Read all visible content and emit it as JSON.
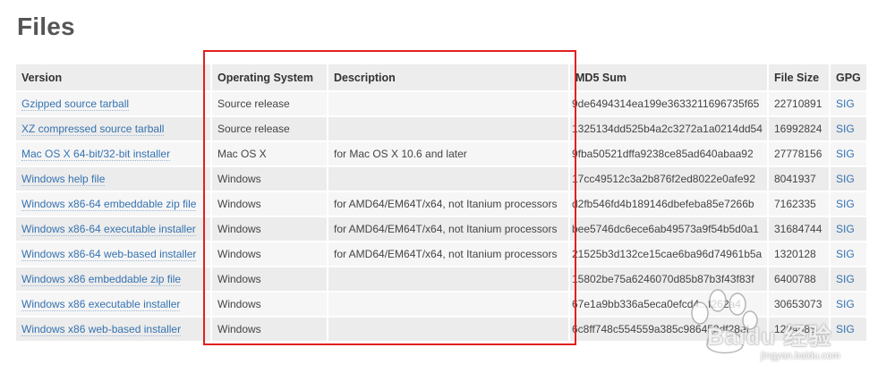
{
  "page": {
    "title": "Files"
  },
  "table": {
    "headers": {
      "version": "Version",
      "os": "Operating System",
      "description": "Description",
      "md5": "MD5 Sum",
      "size": "File Size",
      "gpg": "GPG"
    },
    "rows": [
      {
        "version": "Gzipped source tarball",
        "os": "Source release",
        "description": "",
        "md5": "9de6494314ea199e3633211696735f65",
        "size": "22710891",
        "gpg": "SIG"
      },
      {
        "version": "XZ compressed source tarball",
        "os": "Source release",
        "description": "",
        "md5": "1325134dd525b4a2c3272a1a0214dd54",
        "size": "16992824",
        "gpg": "SIG"
      },
      {
        "version": "Mac OS X 64-bit/32-bit installer",
        "os": "Mac OS X",
        "description": "for Mac OS X 10.6 and later",
        "md5": "9fba50521dffa9238ce85ad640abaa92",
        "size": "27778156",
        "gpg": "SIG"
      },
      {
        "version": "Windows help file",
        "os": "Windows",
        "description": "",
        "md5": "17cc49512c3a2b876f2ed8022e0afe92",
        "size": "8041937",
        "gpg": "SIG"
      },
      {
        "version": "Windows x86-64 embeddable zip file",
        "os": "Windows",
        "description": "for AMD64/EM64T/x64, not Itanium processors",
        "md5": "d2fb546fd4b189146dbefeba85e7266b",
        "size": "7162335",
        "gpg": "SIG"
      },
      {
        "version": "Windows x86-64 executable installer",
        "os": "Windows",
        "description": "for AMD64/EM64T/x64, not Itanium processors",
        "md5": "bee5746dc6ece6ab49573a9f54b5d0a1",
        "size": "31684744",
        "gpg": "SIG"
      },
      {
        "version": "Windows x86-64 web-based installer",
        "os": "Windows",
        "description": "for AMD64/EM64T/x64, not Itanium processors",
        "md5": "21525b3d132ce15cae6ba96d74961b5a",
        "size": "1320128",
        "gpg": "SIG"
      },
      {
        "version": "Windows x86 embeddable zip file",
        "os": "Windows",
        "description": "",
        "md5": "15802be75a6246070d85b87b3f43f83f",
        "size": "6400788",
        "gpg": "SIG"
      },
      {
        "version": "Windows x86 executable installer",
        "os": "Windows",
        "description": "",
        "md5": "67e1a9bb336a5eca0efcd4...f262a4",
        "size": "30653073",
        "gpg": "SIG"
      },
      {
        "version": "Windows x86 web-based installer",
        "os": "Windows",
        "description": "",
        "md5": "6c8ff748c554559a385c986453df28ef",
        "size": "1294088",
        "gpg": "SIG"
      }
    ]
  },
  "annotation": {
    "box_color": "#e02020"
  },
  "watermark": {
    "brand": "Baidu 经验",
    "url": "jingyan.baidu.com"
  },
  "colors": {
    "link": "#3572b0",
    "header_bg": "#ededed",
    "row_odd": "#f6f6f6",
    "row_even": "#ececec"
  }
}
